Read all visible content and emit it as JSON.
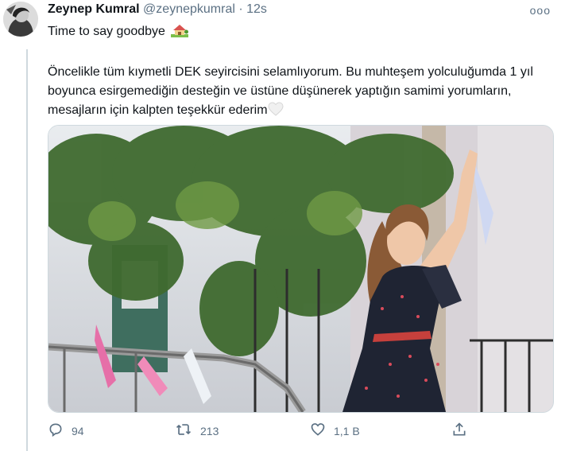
{
  "tweet": {
    "author_name": "Zeynep Kumral",
    "handle": "@zeynepkumral",
    "separator": "·",
    "time": "12s",
    "more_label": "ooo",
    "first_line": "Time to say goodbye",
    "first_line_emoji": "house-with-garden-icon",
    "body": "Öncelikle tüm kıymetli DEK seyircisini selamlıyorum. Bu muhteşem yolculuğumda 1 yıl boyunca esirgemediğin desteğin ve üstüne düşünerek yaptığın samimi yorumların, mesajların için kalpten teşekkür ederim",
    "body_emoji": "white-heart-icon"
  },
  "actions": {
    "reply_count": "94",
    "retweet_count": "213",
    "like_count": "1,1 B"
  },
  "colors": {
    "text": "#0f1419",
    "secondary": "#5b7083",
    "border": "#cfd9de"
  }
}
